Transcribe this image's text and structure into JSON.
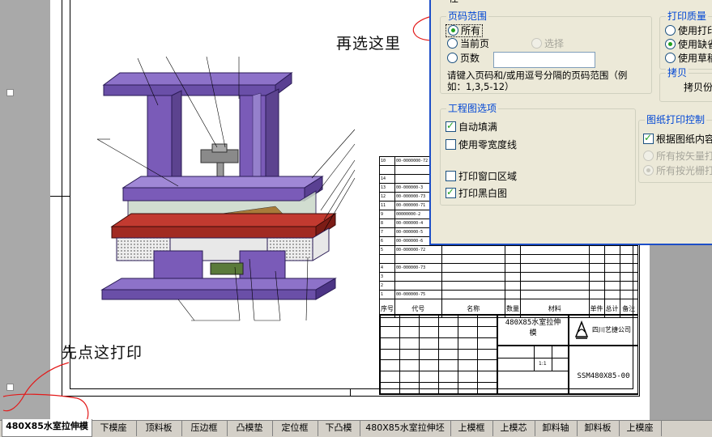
{
  "annotations": {
    "select_here": "再选这里",
    "click_print_first": "先点这打印"
  },
  "dialog": {
    "cutoff_top_label": "任",
    "page_range": {
      "title": "页码范围",
      "all": "所有",
      "current_page": "当前页",
      "selection": "选择",
      "pages": "页数",
      "pages_value": "",
      "hint": "请键入页码和/或用逗号分隔的页码范围（例如：1,3,5-12）"
    },
    "print_quality": {
      "title": "打印质量",
      "opt1": "使用打印",
      "opt2": "使用缺省",
      "opt3": "使用草稿"
    },
    "copies": {
      "title": "拷贝",
      "label": "拷贝份"
    },
    "drawing_options": {
      "title": "工程图选项",
      "auto_fill": "自动填满",
      "zero_width": "使用零宽度线",
      "print_window": "打印窗口区域",
      "print_bw": "打印黑白图"
    },
    "sheet_print": {
      "title": "图纸打印控制",
      "by_content": "根据图纸内容",
      "vector": "所有按矢量打",
      "raster": "所有按光栅打"
    }
  },
  "title_block": {
    "part_name_1": "480X85水室拉伸",
    "part_name_2": "模",
    "company": "四川艺捷公司",
    "drawing_code": "SSM480X85-00",
    "scale_value": "1:1"
  },
  "bom_header": {
    "seq": "序号",
    "code": "代号",
    "name": "名称",
    "qty": "数量",
    "material": "材料",
    "unit_weight": "单件",
    "total_weight": "总计",
    "remark": "备注"
  },
  "bom_rows": [
    [
      "10",
      "00-0000000-72",
      "",
      "",
      "",
      "",
      "",
      ""
    ],
    [
      "",
      "",
      "",
      "",
      "",
      "",
      "",
      ""
    ],
    [
      "14",
      "",
      "",
      "",
      "",
      "",
      "",
      ""
    ],
    [
      "13",
      "00-000000-3",
      "",
      "",
      "",
      "",
      "",
      ""
    ],
    [
      "12",
      "00-000000-73",
      "",
      "",
      "",
      "",
      "",
      ""
    ],
    [
      "11",
      "00-000000-71",
      "",
      "",
      "",
      "",
      "",
      ""
    ],
    [
      "9",
      "00000000-2",
      "",
      "",
      "",
      "",
      "",
      ""
    ],
    [
      "8",
      "00-000000-4",
      "",
      "",
      "",
      "",
      "",
      ""
    ],
    [
      "7",
      "00-000000-5",
      "",
      "",
      "",
      "",
      "",
      ""
    ],
    [
      "6",
      "00-000000-6",
      "",
      "",
      "",
      "",
      "",
      ""
    ],
    [
      "5",
      "00-000000-72",
      "",
      "",
      "",
      "",
      "",
      ""
    ],
    [
      "",
      "",
      "",
      "",
      "",
      "",
      "",
      ""
    ],
    [
      "4",
      "00-000000-73",
      "",
      "",
      "",
      "",
      "",
      ""
    ],
    [
      "3",
      "",
      "",
      "",
      "",
      "",
      "",
      ""
    ],
    [
      "2",
      "",
      "",
      "",
      "",
      "",
      "",
      ""
    ],
    [
      "1",
      "00-000000-75",
      "",
      "",
      "",
      "",
      "",
      ""
    ]
  ],
  "sheet_tabs": [
    {
      "label": "480X85水室拉伸模",
      "active": true
    },
    {
      "label": "下模座",
      "active": false
    },
    {
      "label": "顶料板",
      "active": false
    },
    {
      "label": "压边框",
      "active": false
    },
    {
      "label": "凸模垫",
      "active": false
    },
    {
      "label": "定位框",
      "active": false
    },
    {
      "label": "下凸模",
      "active": false
    },
    {
      "label": "480X85水室拉伸坯",
      "active": false
    },
    {
      "label": "上模框",
      "active": false
    },
    {
      "label": "上模芯",
      "active": false
    },
    {
      "label": "卸料轴",
      "active": false
    },
    {
      "label": "卸料板",
      "active": false
    },
    {
      "label": "上模座",
      "active": false
    }
  ],
  "colors": {
    "press_purple": "#7a5bb8",
    "press_dark": "#4c3485",
    "red_plate": "#a12a22",
    "annotation_red": "#e31a1a",
    "dialog_bg": "#ece9d8",
    "group_title_blue": "#0046d5",
    "xp_blue": "#1c4ec8"
  }
}
